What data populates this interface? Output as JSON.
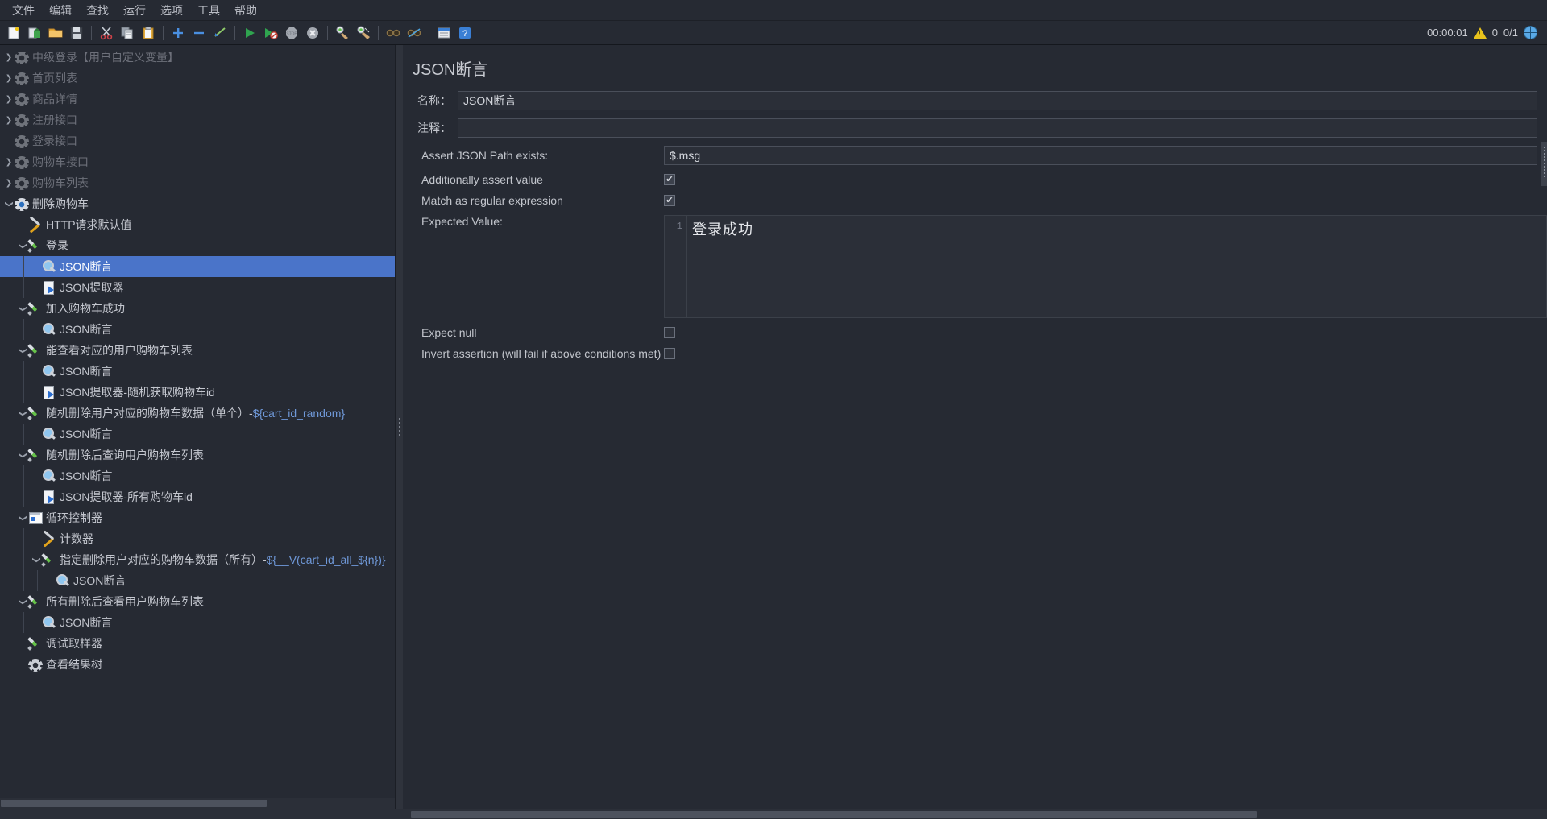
{
  "app": {
    "theme_bg": "#262a33",
    "accent": "#4a74c9"
  },
  "menubar": {
    "items": [
      {
        "label": "文件",
        "name": "menu-file"
      },
      {
        "label": "编辑",
        "name": "menu-edit"
      },
      {
        "label": "查找",
        "name": "menu-search"
      },
      {
        "label": "运行",
        "name": "menu-run"
      },
      {
        "label": "选项",
        "name": "menu-options"
      },
      {
        "label": "工具",
        "name": "menu-tools"
      },
      {
        "label": "帮助",
        "name": "menu-help"
      }
    ]
  },
  "toolbar": {
    "buttons": [
      {
        "icon": "new-file-icon",
        "glyph": "📄"
      },
      {
        "icon": "open-template-icon",
        "glyph": "🗂"
      },
      {
        "icon": "open-folder-icon",
        "glyph": "📂"
      },
      {
        "icon": "save-icon",
        "glyph": "💾"
      },
      {
        "sep": true
      },
      {
        "icon": "cut-icon",
        "glyph": "✂"
      },
      {
        "icon": "copy-icon",
        "glyph": "📋"
      },
      {
        "icon": "paste-icon",
        "glyph": "📑"
      },
      {
        "sep": true
      },
      {
        "icon": "expand-all-icon",
        "glyph": "＋"
      },
      {
        "icon": "collapse-all-icon",
        "glyph": "－"
      },
      {
        "icon": "toggle-icon",
        "glyph": "✎"
      },
      {
        "sep": true
      },
      {
        "icon": "start-icon",
        "glyph": "▶"
      },
      {
        "icon": "start-no-pauses-icon",
        "glyph": "▶"
      },
      {
        "icon": "stop-icon",
        "glyph": "STOP"
      },
      {
        "icon": "shutdown-icon",
        "glyph": "✖"
      },
      {
        "sep": true
      },
      {
        "icon": "clear-icon",
        "glyph": "🧹"
      },
      {
        "icon": "clear-all-icon",
        "glyph": "🧹"
      },
      {
        "sep": true
      },
      {
        "icon": "search-icon",
        "glyph": "🔍"
      },
      {
        "icon": "search-reset-icon",
        "glyph": "🔎"
      },
      {
        "sep": true
      },
      {
        "icon": "function-helper-icon",
        "glyph": "▤"
      },
      {
        "icon": "help-icon",
        "glyph": "?"
      }
    ],
    "status": {
      "elapsed": "00:00:01",
      "warning_icon": "warning-icon",
      "warning_count": "0",
      "threads": "0/1",
      "remote_icon": "remote-engine-icon"
    }
  },
  "tree": {
    "items": [
      {
        "label": "中级登录【用户自定义变量】",
        "icon": "gear-icon",
        "indent": 0,
        "toggle": "collapsed",
        "disabled": true,
        "selected": false,
        "name": "tree-item-thread-group-login"
      },
      {
        "label": "首页列表",
        "icon": "gear-icon",
        "indent": 0,
        "toggle": "collapsed",
        "disabled": true,
        "selected": false,
        "name": "tree-item-home-list"
      },
      {
        "label": "商品详情",
        "icon": "gear-icon",
        "indent": 0,
        "toggle": "collapsed",
        "disabled": true,
        "selected": false,
        "name": "tree-item-product-detail"
      },
      {
        "label": "注册接口",
        "icon": "gear-icon",
        "indent": 0,
        "toggle": "collapsed",
        "disabled": true,
        "selected": false,
        "name": "tree-item-register-api"
      },
      {
        "label": "登录接口",
        "icon": "gear-icon",
        "indent": 0,
        "toggle": "none",
        "disabled": true,
        "selected": false,
        "name": "tree-item-login-api"
      },
      {
        "label": "购物车接口",
        "icon": "gear-icon",
        "indent": 0,
        "toggle": "collapsed",
        "disabled": true,
        "selected": false,
        "name": "tree-item-cart-api"
      },
      {
        "label": "购物车列表",
        "icon": "gear-icon",
        "indent": 0,
        "toggle": "collapsed",
        "disabled": true,
        "selected": false,
        "name": "tree-item-cart-list"
      },
      {
        "label": "删除购物车",
        "icon": "gear-icon-active",
        "indent": 0,
        "toggle": "expanded",
        "disabled": false,
        "selected": false,
        "name": "tree-item-delete-cart"
      },
      {
        "label": "HTTP请求默认值",
        "icon": "tools-icon",
        "indent": 1,
        "toggle": "none",
        "disabled": false,
        "selected": false,
        "name": "tree-item-http-defaults"
      },
      {
        "label": "登录",
        "icon": "pen-icon",
        "indent": 1,
        "toggle": "expanded",
        "disabled": false,
        "selected": false,
        "name": "tree-item-sampler-login"
      },
      {
        "label": "JSON断言",
        "icon": "assert-icon",
        "indent": 2,
        "toggle": "none",
        "disabled": false,
        "selected": true,
        "name": "tree-item-json-assertion-login"
      },
      {
        "label": "JSON提取器",
        "icon": "extract-icon",
        "indent": 2,
        "toggle": "none",
        "disabled": false,
        "selected": false,
        "name": "tree-item-json-extractor-login"
      },
      {
        "label": "加入购物车成功",
        "icon": "pen-icon",
        "indent": 1,
        "toggle": "expanded",
        "disabled": false,
        "selected": false,
        "name": "tree-item-sampler-add-cart"
      },
      {
        "label": "JSON断言",
        "icon": "assert-icon",
        "indent": 2,
        "toggle": "none",
        "disabled": false,
        "selected": false,
        "name": "tree-item-json-assertion-add-cart"
      },
      {
        "label": "能查看对应的用户购物车列表",
        "icon": "pen-icon",
        "indent": 1,
        "toggle": "expanded",
        "disabled": false,
        "selected": false,
        "name": "tree-item-sampler-view-cart-list"
      },
      {
        "label": "JSON断言",
        "icon": "assert-icon",
        "indent": 2,
        "toggle": "none",
        "disabled": false,
        "selected": false,
        "name": "tree-item-json-assertion-view-cart"
      },
      {
        "label": "JSON提取器-随机获取购物车id",
        "icon": "extract-icon",
        "indent": 2,
        "toggle": "none",
        "disabled": false,
        "selected": false,
        "name": "tree-item-json-extractor-random-cart-id"
      },
      {
        "label": "随机删除用户对应的购物车数据（单个）-",
        "var": "${cart_id_random}",
        "icon": "pen-icon",
        "indent": 1,
        "toggle": "expanded",
        "disabled": false,
        "selected": false,
        "name": "tree-item-sampler-random-delete-single"
      },
      {
        "label": "JSON断言",
        "icon": "assert-icon",
        "indent": 2,
        "toggle": "none",
        "disabled": false,
        "selected": false,
        "name": "tree-item-json-assertion-random-delete"
      },
      {
        "label": "随机删除后查询用户购物车列表",
        "icon": "pen-icon",
        "indent": 1,
        "toggle": "expanded",
        "disabled": false,
        "selected": false,
        "name": "tree-item-sampler-query-after-random-delete"
      },
      {
        "label": "JSON断言",
        "icon": "assert-icon",
        "indent": 2,
        "toggle": "none",
        "disabled": false,
        "selected": false,
        "name": "tree-item-json-assertion-query-after-delete"
      },
      {
        "label": "JSON提取器-所有购物车id",
        "icon": "extract-icon",
        "indent": 2,
        "toggle": "none",
        "disabled": false,
        "selected": false,
        "name": "tree-item-json-extractor-all-cart-ids"
      },
      {
        "label": "循环控制器",
        "icon": "loop-icon",
        "indent": 1,
        "toggle": "expanded",
        "disabled": false,
        "selected": false,
        "name": "tree-item-loop-controller"
      },
      {
        "label": "计数器",
        "icon": "tools-icon",
        "indent": 2,
        "toggle": "none",
        "disabled": false,
        "selected": false,
        "name": "tree-item-counter"
      },
      {
        "label": "指定删除用户对应的购物车数据（所有）-",
        "var": "${__V(cart_id_all_${n})}",
        "icon": "pen-icon",
        "indent": 2,
        "toggle": "expanded",
        "disabled": false,
        "selected": false,
        "name": "tree-item-sampler-delete-all"
      },
      {
        "label": "JSON断言",
        "icon": "assert-icon",
        "indent": 3,
        "toggle": "none",
        "disabled": false,
        "selected": false,
        "name": "tree-item-json-assertion-delete-all"
      },
      {
        "label": "所有删除后查看用户购物车列表",
        "icon": "pen-icon",
        "indent": 1,
        "toggle": "expanded",
        "disabled": false,
        "selected": false,
        "name": "tree-item-sampler-view-after-all-delete"
      },
      {
        "label": "JSON断言",
        "icon": "assert-icon",
        "indent": 2,
        "toggle": "none",
        "disabled": false,
        "selected": false,
        "name": "tree-item-json-assertion-view-after-all-delete"
      },
      {
        "label": "调试取样器",
        "icon": "pen-icon",
        "indent": 1,
        "toggle": "none",
        "disabled": false,
        "selected": false,
        "name": "tree-item-debug-sampler"
      },
      {
        "label": "查看结果树",
        "icon": "gear-icon",
        "indent": 1,
        "toggle": "none",
        "disabled": false,
        "selected": false,
        "name": "tree-item-view-results-tree"
      }
    ]
  },
  "panel": {
    "title": "JSON断言",
    "name_label": "名称：",
    "name_value": "JSON断言",
    "comment_label": "注释：",
    "comment_value": "",
    "comment_placeholder": "",
    "assert_path_label": "Assert JSON Path exists:",
    "assert_path_value": "$.msg",
    "additionally_assert_label": "Additionally assert value",
    "additionally_assert_checked": true,
    "match_regex_label": "Match as regular expression",
    "match_regex_checked": true,
    "expected_value_label": "Expected Value:",
    "expected_value_line_no": "1",
    "expected_value_text": "登录成功",
    "expect_null_label": "Expect null",
    "expect_null_checked": false,
    "invert_label": "Invert assertion (will fail if above conditions met)",
    "invert_checked": false,
    "check_glyph": "✔"
  }
}
